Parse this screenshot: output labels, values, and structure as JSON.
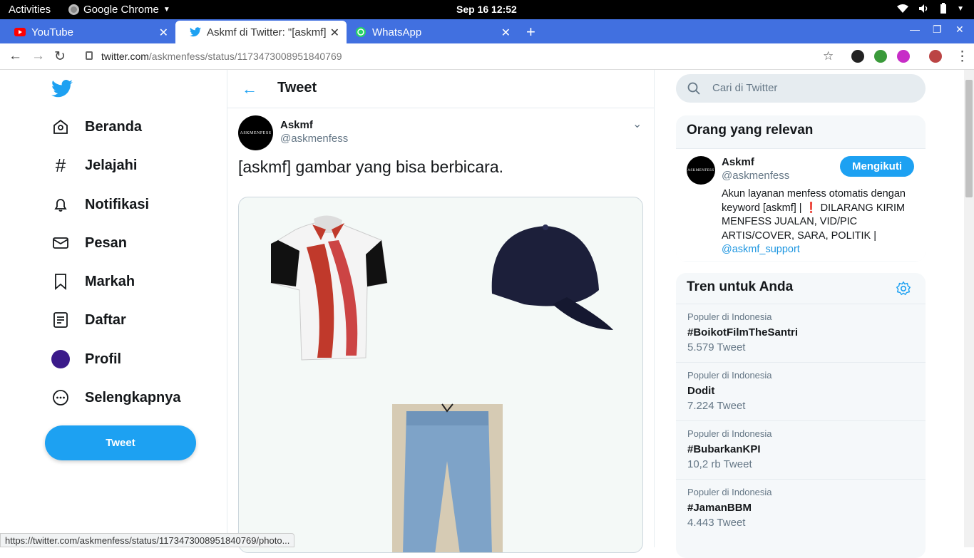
{
  "system_bar": {
    "activities": "Activities",
    "app_name": "Google Chrome",
    "clock": "Sep 16  12:52"
  },
  "browser": {
    "tabs": [
      {
        "label": "YouTube",
        "icon": "youtube-icon"
      },
      {
        "label": "Askmf di Twitter: \"[askmf] g",
        "icon": "twitter-icon"
      },
      {
        "label": "WhatsApp",
        "icon": "whatsapp-icon"
      }
    ],
    "url_host": "twitter.com",
    "url_path": "/askmenfess/status/1173473008951840769",
    "status_url": "https://twitter.com/askmenfess/status/1173473008951840769/photo..."
  },
  "nav": {
    "items": [
      {
        "label": "Beranda",
        "icon": "home-icon"
      },
      {
        "label": "Jelajahi",
        "icon": "hashtag-icon"
      },
      {
        "label": "Notifikasi",
        "icon": "bell-icon"
      },
      {
        "label": "Pesan",
        "icon": "mail-icon"
      },
      {
        "label": "Markah",
        "icon": "bookmark-icon"
      },
      {
        "label": "Daftar",
        "icon": "list-icon"
      },
      {
        "label": "Profil",
        "icon": "profile-avatar-icon"
      },
      {
        "label": "Selengkapnya",
        "icon": "more-icon"
      }
    ],
    "tweet_button": "Tweet"
  },
  "main": {
    "header_title": "Tweet",
    "author_name": "Askmf",
    "author_handle": "@askmenfess",
    "avatar_text": "ASKMENFESS",
    "tweet_text": "[askmf] gambar yang bisa berbicara."
  },
  "sidebar": {
    "search_placeholder": "Cari di Twitter",
    "relevant_title": "Orang yang relevan",
    "relevant_user": {
      "name": "Askmf",
      "handle": "@askmenfess",
      "follow_label": "Mengikuti",
      "bio": "Akun layanan menfess otomatis dengan keyword [askmf] | ❗ DILARANG KIRIM MENFESS JUALAN, VID/PIC ARTIS/COVER, SARA, POLITIK | ",
      "bio_link": "@askmf_support"
    },
    "trends_title": "Tren untuk Anda",
    "trends": [
      {
        "context": "Populer di Indonesia",
        "name": "#BoikotFilmTheSantri",
        "count": "5.579 Tweet"
      },
      {
        "context": "Populer di Indonesia",
        "name": "Dodit",
        "count": "7.224 Tweet"
      },
      {
        "context": "Populer di Indonesia",
        "name": "#BubarkanKPI",
        "count": "10,2 rb Tweet"
      },
      {
        "context": "Populer di Indonesia",
        "name": "#JamanBBM",
        "count": "4.443 Tweet"
      }
    ]
  },
  "colors": {
    "twitter_blue": "#1da1f2",
    "chrome_tab_bar": "#4170e0"
  }
}
